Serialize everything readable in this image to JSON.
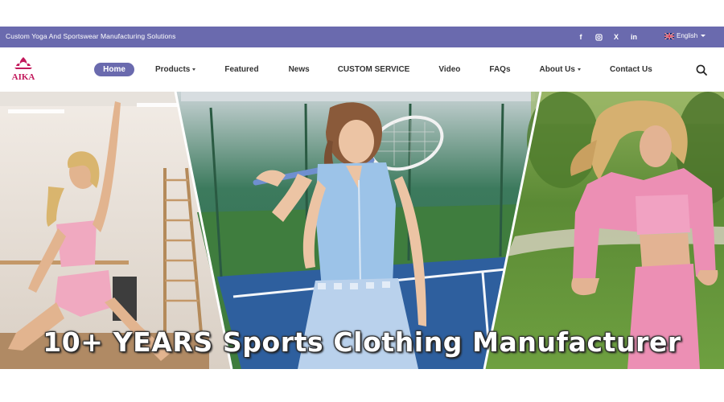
{
  "topbar": {
    "tagline": "Custom Yoga And Sportswear Manufacturing Solutions",
    "social": [
      {
        "icon": "facebook-icon",
        "glyph": "f"
      },
      {
        "icon": "instagram-icon",
        "glyph": "◙"
      },
      {
        "icon": "x-twitter-icon",
        "glyph": "X"
      },
      {
        "icon": "linkedin-icon",
        "glyph": "in"
      }
    ],
    "language": "English"
  },
  "nav": {
    "logo_text": "AIKA",
    "items": [
      {
        "label": "Home",
        "active": true,
        "dropdown": false
      },
      {
        "label": "Products",
        "active": false,
        "dropdown": true
      },
      {
        "label": "Featured",
        "active": false,
        "dropdown": false
      },
      {
        "label": "News",
        "active": false,
        "dropdown": false
      },
      {
        "label": "CUSTOM SERVICE",
        "active": false,
        "dropdown": false
      },
      {
        "label": "Video",
        "active": false,
        "dropdown": false
      },
      {
        "label": "FAQs",
        "active": false,
        "dropdown": false
      },
      {
        "label": "About Us",
        "active": false,
        "dropdown": true
      },
      {
        "label": "Contact Us",
        "active": false,
        "dropdown": false
      }
    ]
  },
  "hero": {
    "title": "10+ YEARS Sports Clothing Manufacturer"
  },
  "colors": {
    "brand": "#6a6aae",
    "logo": "#c2185b"
  }
}
